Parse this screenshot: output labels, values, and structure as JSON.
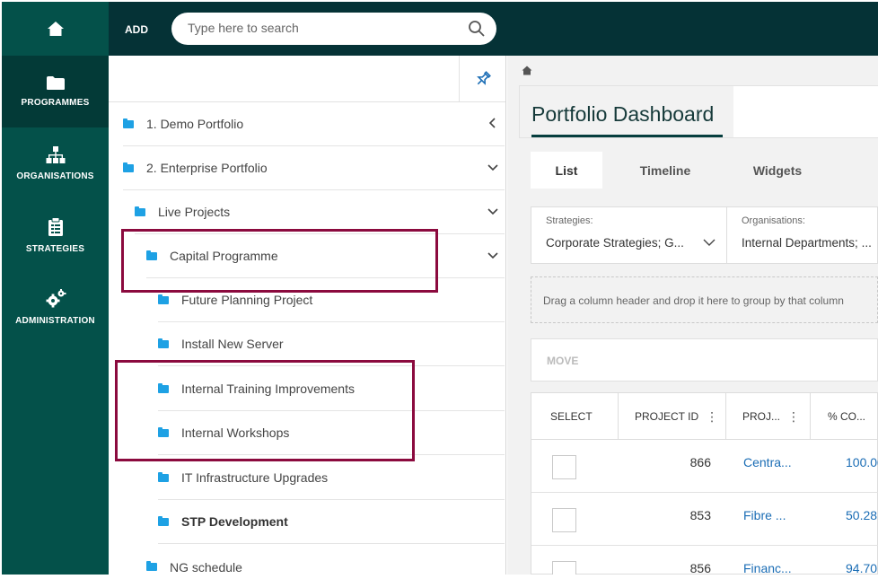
{
  "nav": {
    "items": [
      {
        "label": "PROGRAMMES",
        "icon": "folder-icon",
        "active": true
      },
      {
        "label": "ORGANISATIONS",
        "icon": "org-chart-icon",
        "active": false
      },
      {
        "label": "STRATEGIES",
        "icon": "clipboard-icon",
        "active": false
      },
      {
        "label": "ADMINISTRATION",
        "icon": "gears-icon",
        "active": false
      }
    ]
  },
  "topbar": {
    "add_label": "ADD",
    "search_placeholder": "Type here to search"
  },
  "tree": {
    "rows": [
      {
        "label": "1. Demo Portfolio",
        "chevron": "left"
      },
      {
        "label": "2. Enterprise Portfolio",
        "chevron": "down"
      },
      {
        "label": "Live Projects",
        "chevron": "down"
      },
      {
        "label": "Capital Programme",
        "chevron": "down"
      },
      {
        "label": "Future Planning Project"
      },
      {
        "label": "Install New Server"
      },
      {
        "label": "Internal Training Improvements"
      },
      {
        "label": "Internal Workshops"
      },
      {
        "label": "IT Infrastructure Upgrades"
      },
      {
        "label": "STP Development",
        "bold": true
      },
      {
        "label": "NG schedule"
      }
    ]
  },
  "dashboard": {
    "title": "Portfolio Dashboard",
    "tabs": [
      "List",
      "Timeline",
      "Widgets"
    ],
    "active_tab": "List",
    "filters": [
      {
        "label": "Strategies:",
        "value": "Corporate Strategies; G..."
      },
      {
        "label": "Organisations:",
        "value": "Internal Departments; ..."
      }
    ],
    "group_hint": "Drag a column header and drop it here to group by that column",
    "move_label": "MOVE",
    "columns": [
      "SELECT",
      "PROJECT ID",
      "PROJ...",
      "% CO..."
    ],
    "rows": [
      {
        "id": "866",
        "name": "Centra...",
        "pct": "100.00"
      },
      {
        "id": "853",
        "name": "Fibre ...",
        "pct": "50.28"
      },
      {
        "id": "856",
        "name": "Financ...",
        "pct": "94.70"
      }
    ]
  },
  "colors": {
    "rail": "#04514a",
    "topbar": "#053236",
    "highlight": "#8b0a3e",
    "folder": "#1ea1e4",
    "link": "#1b6db5"
  }
}
